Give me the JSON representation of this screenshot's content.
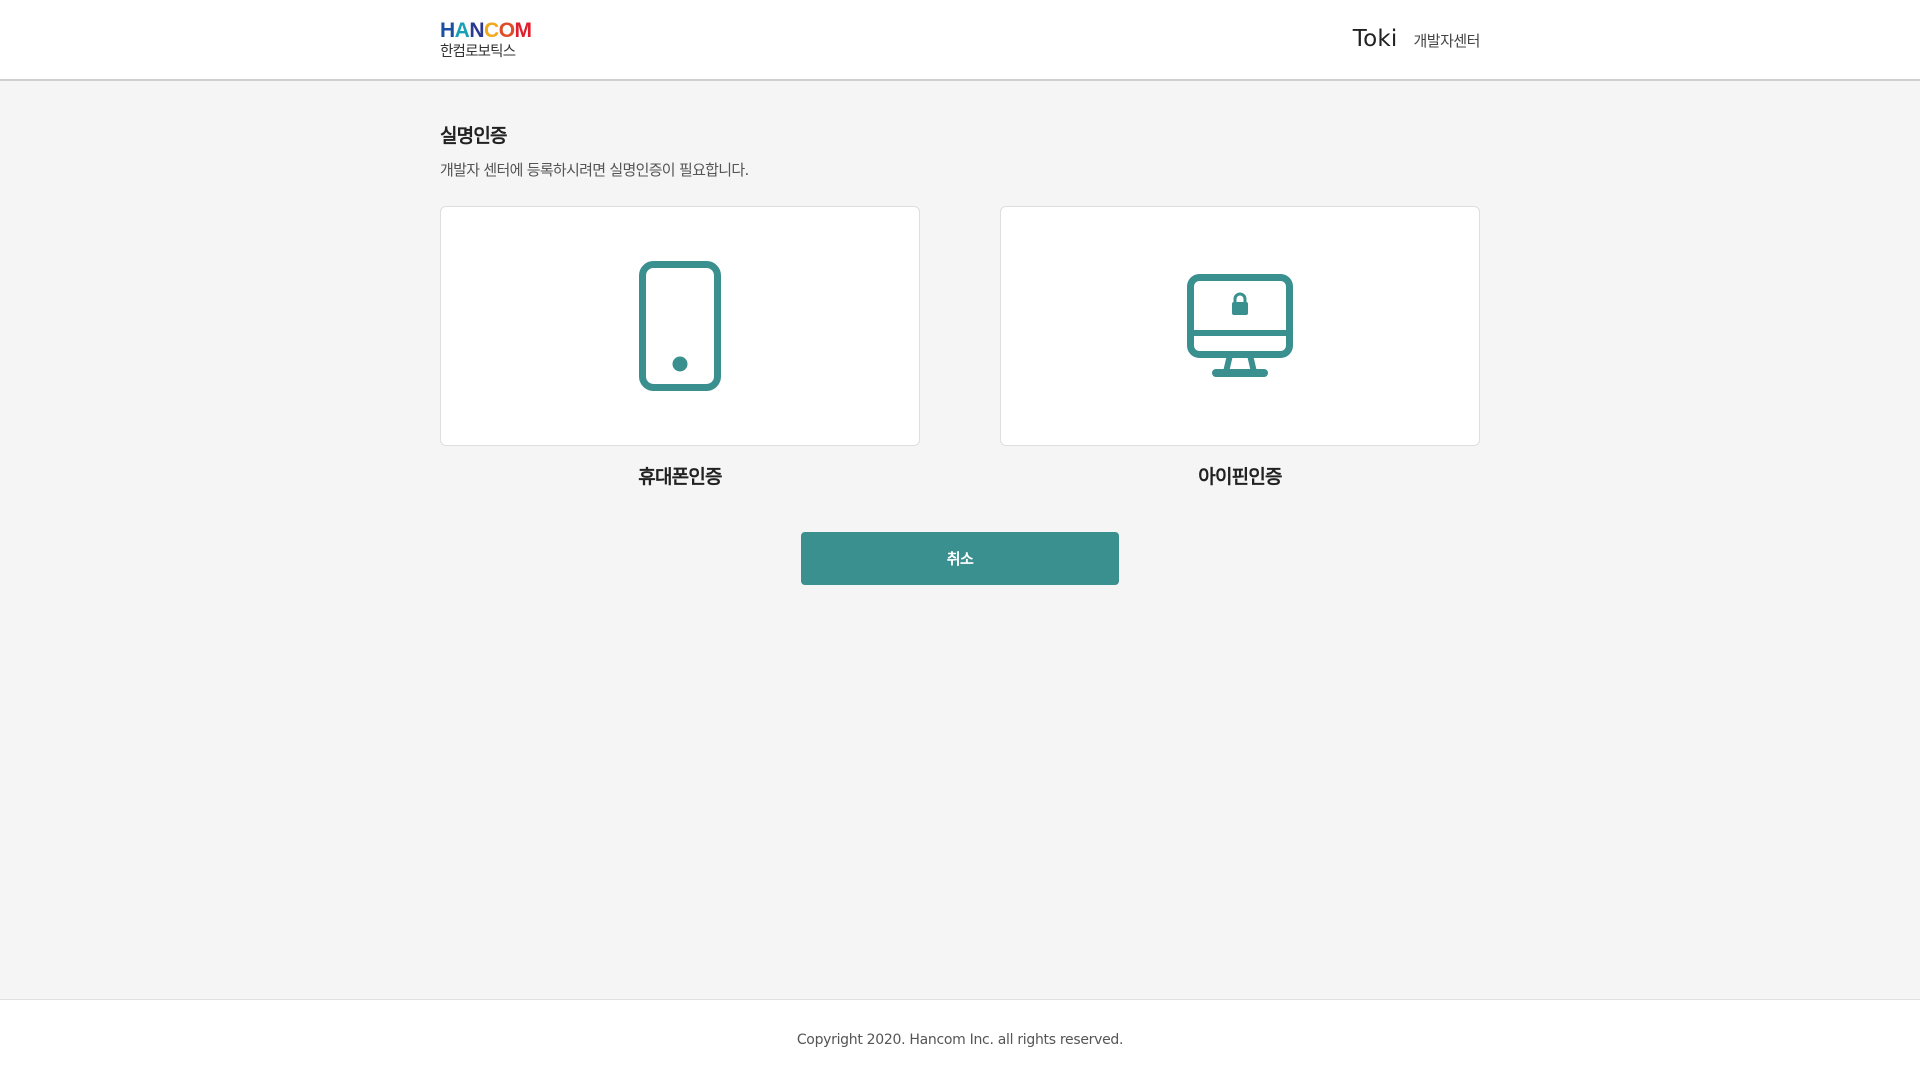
{
  "header": {
    "logo": {
      "wordmark_letters": [
        {
          "char": "H",
          "color": "#1a4fa3"
        },
        {
          "char": "A",
          "color": "#18a0b5"
        },
        {
          "char": "N",
          "color": "#2b3990"
        },
        {
          "char": "C",
          "color": "#f2a81d"
        },
        {
          "char": "O",
          "color": "#e04b2a"
        },
        {
          "char": "M",
          "color": "#e01e2c"
        }
      ],
      "subtitle": "한컴로보틱스"
    },
    "brand_name": "Toki",
    "brand_sub": "개발자센터"
  },
  "main": {
    "title": "실명인증",
    "description": "개발자 센터에 등록하시려면 실명인증이 필요합니다.",
    "options": [
      {
        "label": "휴대폰인증",
        "icon": "smartphone-icon"
      },
      {
        "label": "아이핀인증",
        "icon": "monitor-lock-icon"
      }
    ],
    "cancel_label": "취소"
  },
  "footer": {
    "copyright": "Copyright 2020. Hancom Inc. all rights reserved."
  },
  "colors": {
    "accent": "#3a8f8f",
    "background": "#f5f5f5",
    "surface": "#ffffff"
  }
}
